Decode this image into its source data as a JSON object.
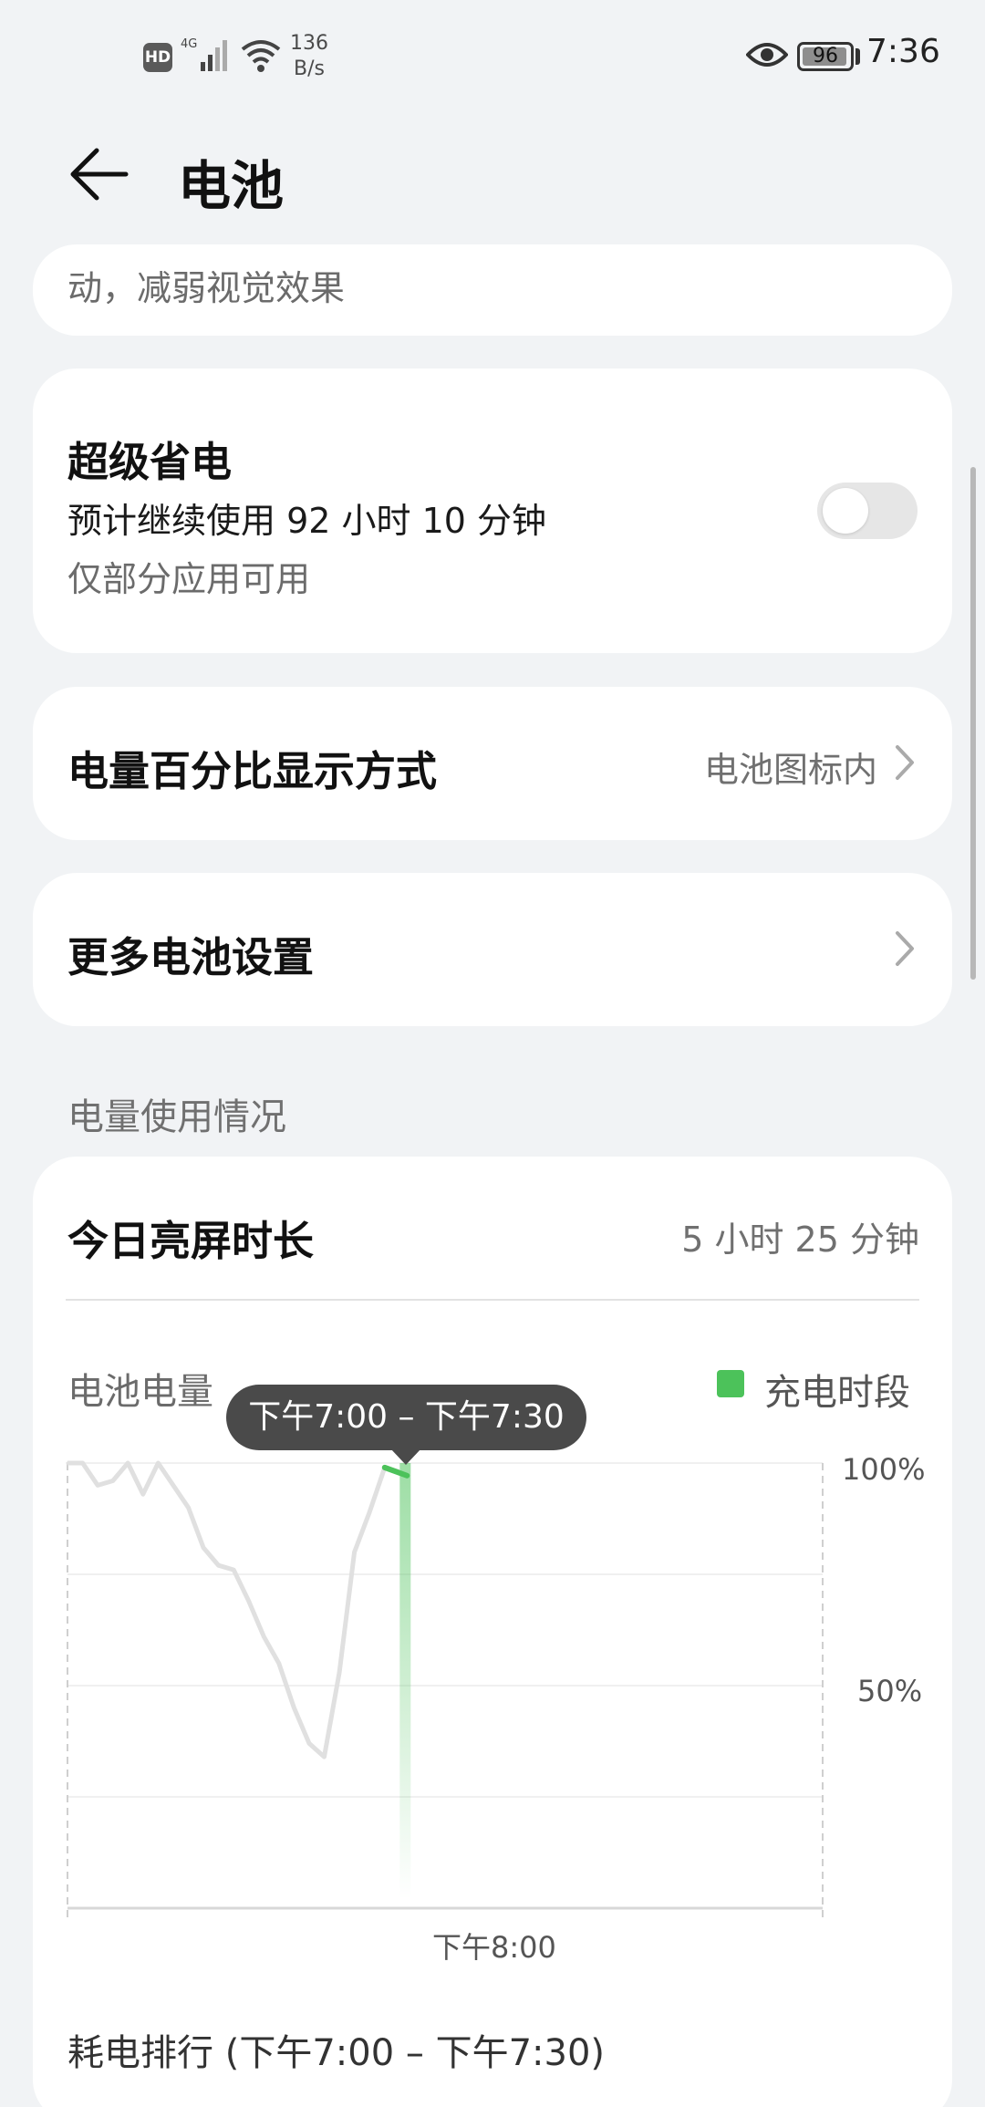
{
  "status_bar": {
    "hd": "HD",
    "network": "4G",
    "speed_value": "136",
    "speed_unit": "B/s",
    "battery_text": "96",
    "battery_level": 0.96,
    "time": "7:36"
  },
  "header": {
    "title": "电池"
  },
  "clipped_card": {
    "text": "动，减弱视觉效果"
  },
  "super_save": {
    "title": "超级省电",
    "estimate": "预计继续使用 92 小时 10 分钟",
    "note": "仅部分应用可用",
    "enabled": false
  },
  "percent_display": {
    "title": "电量百分比显示方式",
    "value": "电池图标内"
  },
  "more_settings": {
    "title": "更多电池设置"
  },
  "usage": {
    "section_title": "电量使用情况",
    "screen_time_label": "今日亮屏时长",
    "screen_time_value": "5 小时 25 分钟",
    "battery_label": "电池电量",
    "legend_label": "充电时段",
    "tooltip": "下午7:00 – 下午7:30",
    "ranking_title": "耗电排行 (下午7:00 – 下午7:30)"
  },
  "colors": {
    "charge_green": "#4cc25a",
    "line_gray": "#e0e0e0",
    "background": "#f1f3f5"
  },
  "chart_data": {
    "type": "line",
    "ylabel": "电池电量",
    "y_ticks": [
      "100%",
      "50%"
    ],
    "x_ticks": [
      "下午8:00"
    ],
    "ylim": [
      0,
      100
    ],
    "series": [
      {
        "name": "电池电量",
        "x": [
          0.0,
          0.02,
          0.04,
          0.06,
          0.08,
          0.1,
          0.12,
          0.14,
          0.16,
          0.18,
          0.2,
          0.22,
          0.24,
          0.26,
          0.28,
          0.3,
          0.32,
          0.34,
          0.36,
          0.38,
          0.4,
          0.42,
          0.44
        ],
        "values": [
          100,
          100,
          95,
          96,
          100,
          93,
          100,
          95,
          90,
          81,
          77,
          76,
          69,
          61,
          55,
          45,
          37,
          34,
          53,
          80,
          89,
          99,
          98
        ]
      }
    ],
    "charging_range": [
      0.44,
      0.45
    ],
    "legend": "充电时段",
    "grid": true
  }
}
